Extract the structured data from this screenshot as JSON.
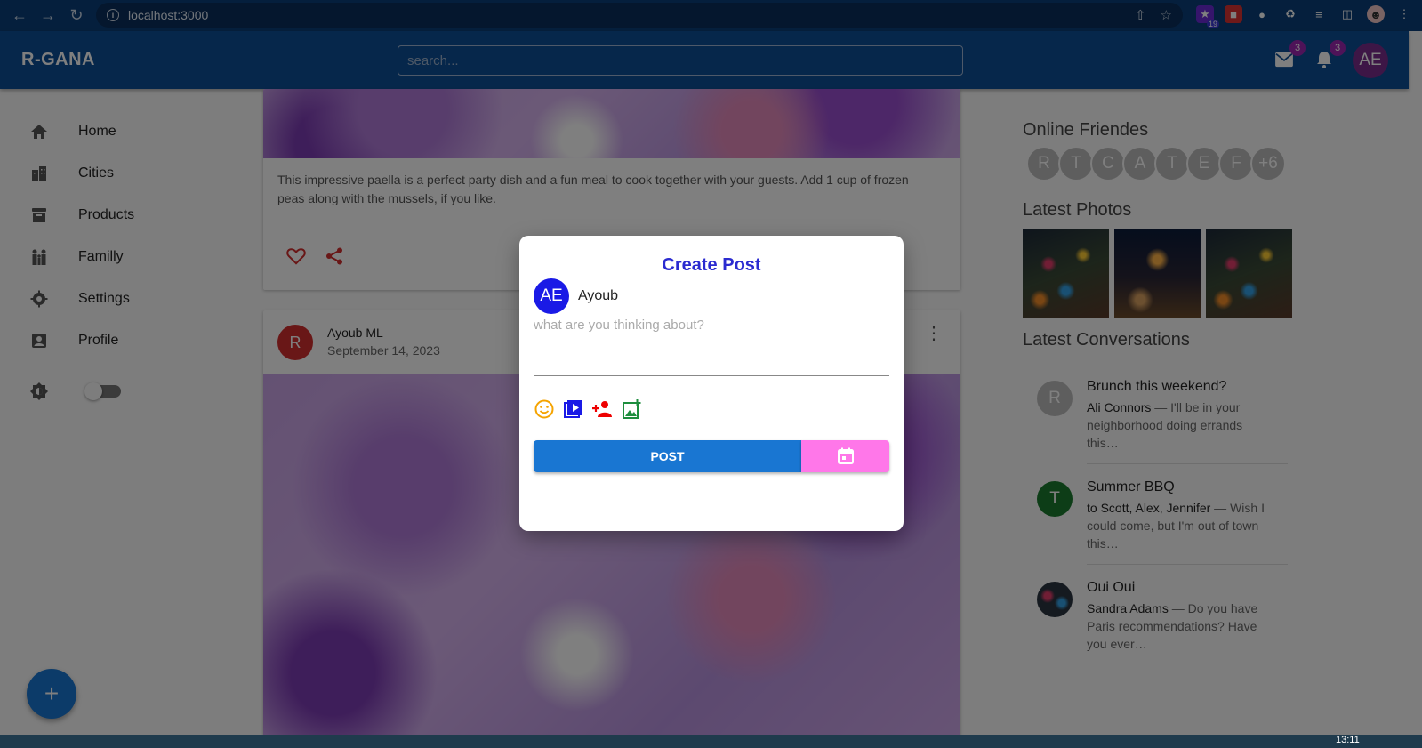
{
  "browser": {
    "url": "localhost:3000",
    "extension_badge": "19"
  },
  "appbar": {
    "brand": "R-GANA",
    "search_placeholder": "search...",
    "mail_count": "3",
    "notification_count": "3",
    "avatar_initials": "AE"
  },
  "sidebar": {
    "items": [
      {
        "label": "Home",
        "icon": "home-icon"
      },
      {
        "label": "Cities",
        "icon": "city-icon"
      },
      {
        "label": "Products",
        "icon": "archive-icon"
      },
      {
        "label": "Familly",
        "icon": "family-icon"
      },
      {
        "label": "Settings",
        "icon": "gear-icon"
      },
      {
        "label": "Profile",
        "icon": "account-box-icon"
      }
    ],
    "theme_toggle": {
      "icon": "brightness-icon",
      "on": false
    },
    "fab_label": "+"
  },
  "feed": {
    "posts": [
      {
        "text": "This impressive paella is a perfect party dish and a fun meal to cook together with your guests. Add 1 cup of frozen peas along with the mussels, if you like."
      },
      {
        "avatar": "R",
        "author": "Ayoub ML",
        "date": "September 14, 2023"
      }
    ]
  },
  "right": {
    "online_title": "Online Friendes",
    "online_friends": [
      "R",
      "T",
      "C",
      "A",
      "T",
      "E",
      "F",
      "+6"
    ],
    "photos_title": "Latest Photos",
    "conversations_title": "Latest Conversations",
    "conversations": [
      {
        "avatar": "R",
        "title": "Brunch this weekend?",
        "sender": "Ali Connors",
        "snippet": " — I'll be in your neighborhood doing errands this…",
        "color": "#bdbdbd"
      },
      {
        "avatar": "T",
        "title": "Summer BBQ",
        "sender": "to Scott, Alex, Jennifer",
        "snippet": " — Wish I could come, but I'm out of town this…",
        "color": "#1b7a2e"
      },
      {
        "avatar": "",
        "title": "Oui Oui",
        "sender": "Sandra Adams",
        "snippet": " — Do you have Paris recommendations? Have you ever…",
        "color": "#3a4a5a"
      }
    ]
  },
  "modal": {
    "title": "Create Post",
    "avatar_initials": "AE",
    "username": "Ayoub",
    "placeholder": "what are you thinking about?",
    "tools": [
      "emoji-icon",
      "video-icon",
      "tag-person-icon",
      "add-photo-icon"
    ],
    "post_label": "POST",
    "colors": {
      "title": "#2b2bd0",
      "post_button": "#1976d2",
      "date_button": "#ff77e9"
    }
  },
  "taskbar": {
    "time": "13:11"
  }
}
